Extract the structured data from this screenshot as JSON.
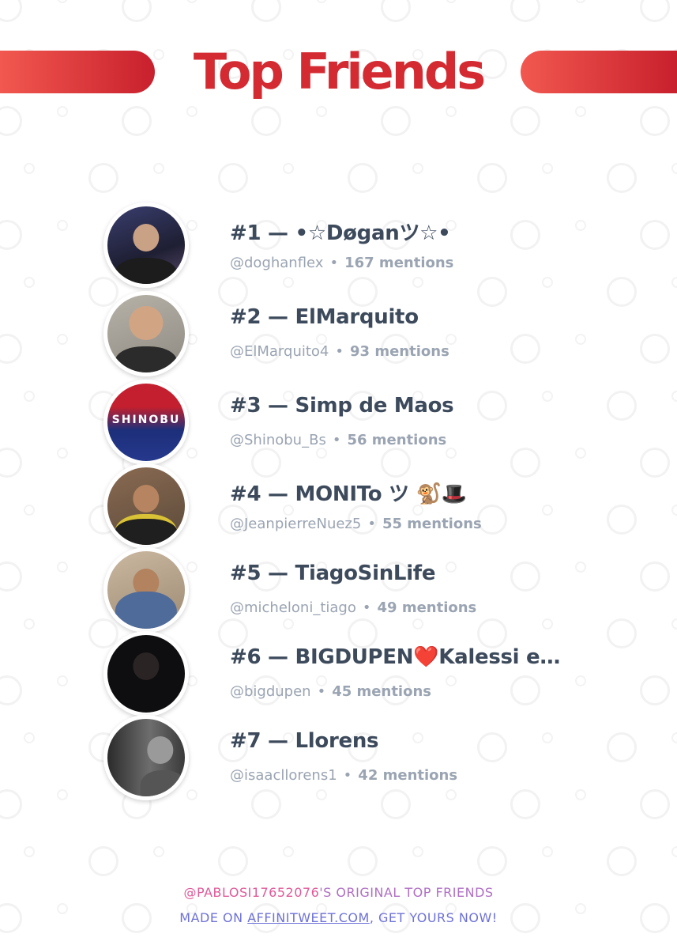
{
  "header": {
    "title": "Top Friends"
  },
  "friends": [
    {
      "rank": "#1",
      "name": "•☆Døganツ☆•",
      "handle": "@doghanflex",
      "mentions": "167 mentions"
    },
    {
      "rank": "#2",
      "name": "ElMarquito",
      "handle": "@ElMarquito4",
      "mentions": "93 mentions"
    },
    {
      "rank": "#3",
      "name": "Simp de Maos",
      "handle": "@Shinobu_Bs",
      "mentions": "56 mentions"
    },
    {
      "rank": "#4",
      "name": "MONITo ツ 🐒🎩",
      "handle": "@JeanpierreNuez5",
      "mentions": "55 mentions"
    },
    {
      "rank": "#5",
      "name": "TiagoSinLife",
      "handle": "@micheloni_tiago",
      "mentions": "49 mentions"
    },
    {
      "rank": "#6",
      "name": "BIGDUPEN❤️Kalessi e…",
      "handle": "@bigdupen",
      "mentions": "45 mentions"
    },
    {
      "rank": "#7",
      "name": "Llorens",
      "handle": "@isaacllorens1",
      "mentions": "42 mentions"
    }
  ],
  "separator": "—",
  "dot": "•",
  "footer": {
    "handle": "@PABLOSI17652076",
    "line1_rest": "'S ORIGINAL TOP FRIENDS",
    "line2_prefix": "MADE ON ",
    "link": "AFFINITWEET.COM",
    "line2_suffix": ", GET YOURS NOW!"
  },
  "colors": {
    "title": "#d42a31",
    "name": "#3c4a5c",
    "sub": "#9aa4b2",
    "bar_start": "#f2584f",
    "bar_end": "#c8202d"
  }
}
